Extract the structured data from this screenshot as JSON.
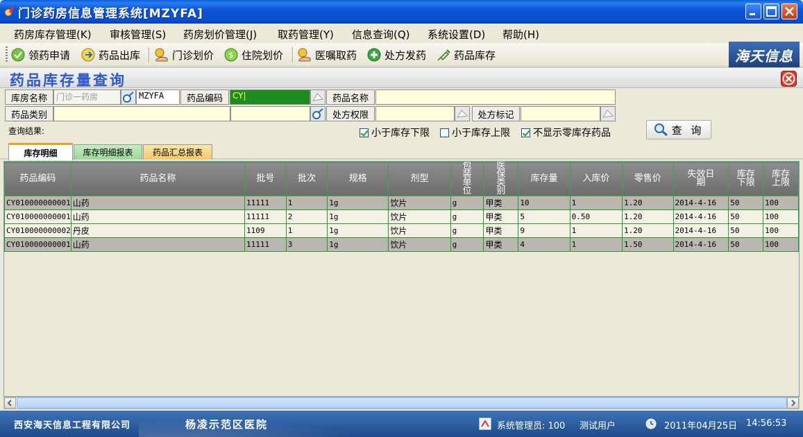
{
  "window": {
    "title": "门诊药房信息管理系统[MZYFA]"
  },
  "menu": [
    "药房库存管理(K)",
    "审核管理(S)",
    "药房划价管理(J)",
    "取药管理(Y)",
    "信息查询(Q)",
    "系统设置(D)",
    "帮助(H)"
  ],
  "toolbar": [
    "领药申请",
    "药品出库",
    "门诊划价",
    "住院划价",
    "医嘱取药",
    "处方发药",
    "药品库存"
  ],
  "logo": "海天信息",
  "page": {
    "title": "药品库存量查询"
  },
  "query": {
    "pharmacy_name_label": "库房名称",
    "pharmacy_name_value": "门诊一药房",
    "pharmacy_code_value": "MZYFA",
    "drug_code_label": "药品编码",
    "drug_code_value": "CY|",
    "drug_name_label": "药品名称",
    "drug_name_value": "",
    "drug_category_label": "药品类别",
    "drug_category_value": "",
    "rx_permission_label": "处方权限",
    "rx_permission_value": "",
    "rx_mark_label": "处方标记",
    "rx_mark_value": "",
    "result_label": "查询结果:",
    "below_min": {
      "label": "小于库存下限",
      "checked": true
    },
    "above_max": {
      "label": "小于库存上限",
      "checked": false
    },
    "hide_zero": {
      "label": "不显示零库存药品",
      "checked": true
    },
    "query_button": "查 询"
  },
  "tabs": [
    {
      "label": "库存明细",
      "active": true
    },
    {
      "label": "库存明细报表",
      "active": false
    },
    {
      "label": "药品汇总报表",
      "active": false
    }
  ],
  "table": {
    "headers": [
      "药品编码",
      "药品名称",
      "批号",
      "批次",
      "规格",
      "剂型",
      "包装单位",
      "医保类别",
      "库存量",
      "入库价",
      "零售价",
      "失效日期",
      "库存下限",
      "库存上限"
    ],
    "rows": [
      [
        "CY010000000001",
        "山药",
        "11111",
        "1",
        "1g",
        "饮片",
        "g",
        "甲类",
        "10",
        "1",
        "1.20",
        "2014-4-16",
        "50",
        "100"
      ],
      [
        "CY010000000001",
        "山药",
        "11111",
        "2",
        "1g",
        "饮片",
        "g",
        "甲类",
        "5",
        "0.50",
        "1.20",
        "2014-4-16",
        "50",
        "100"
      ],
      [
        "CY010000000002",
        "丹皮",
        "1109",
        "1",
        "1g",
        "饮片",
        "g",
        "甲类",
        "9",
        "1",
        "1.20",
        "2014-4-16",
        "50",
        "100"
      ],
      [
        "CY010000000001",
        "山药",
        "11111",
        "3",
        "1g",
        "饮片",
        "g",
        "甲类",
        "4",
        "1",
        "1.50",
        "2014-4-16",
        "50",
        "100"
      ]
    ]
  },
  "status": {
    "company": "西安海天信息工程有限公司",
    "hospital": "杨凌示范区医院",
    "user": "系统管理员: 100",
    "user_name": "测试用户",
    "date": "2011年04月25日",
    "time": "14:56:53"
  },
  "colors": {
    "title_blue": "#0a56d6",
    "page_title": "#2e59c9",
    "grid_border": "#2b952b",
    "row_gray": "#b9b7b0",
    "row_light": "#f3f1e6"
  }
}
